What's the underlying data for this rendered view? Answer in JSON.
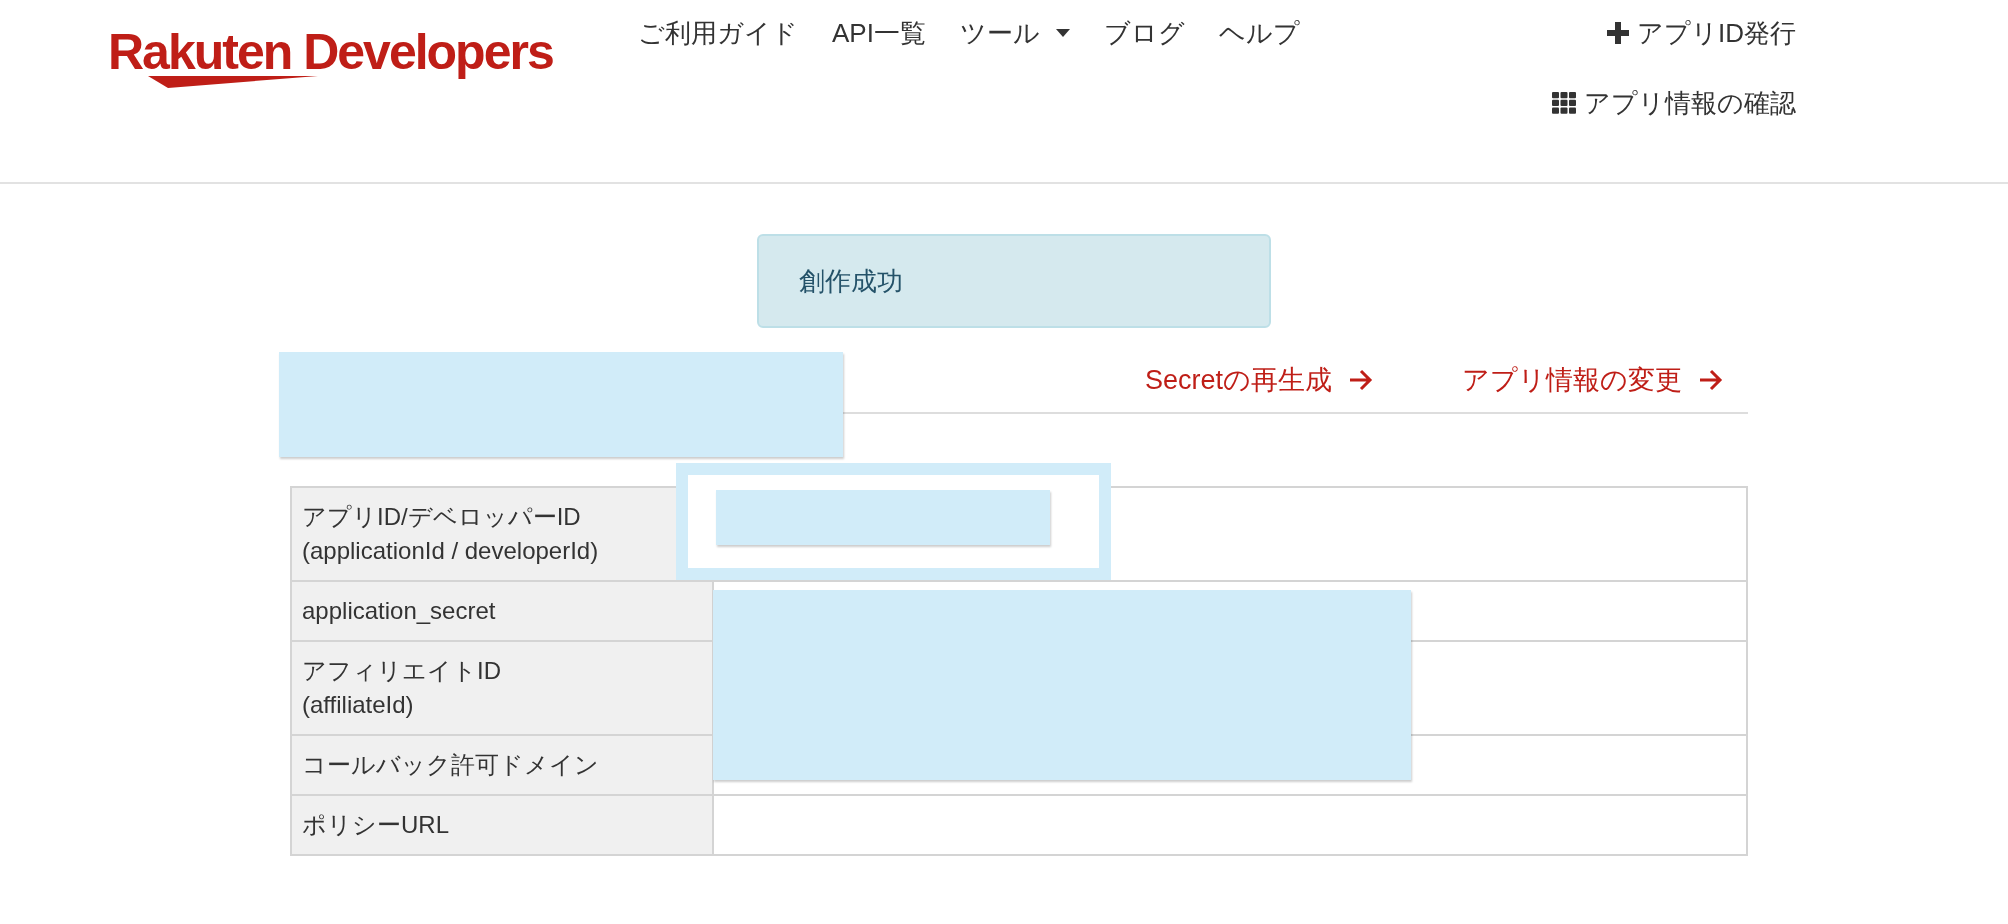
{
  "header": {
    "logo": "Rakuten Developers",
    "nav": [
      {
        "label": "ご利用ガイド",
        "dropdown": false
      },
      {
        "label": "API一覧",
        "dropdown": false
      },
      {
        "label": "ツール",
        "dropdown": true
      },
      {
        "label": "ブログ",
        "dropdown": false
      },
      {
        "label": "ヘルプ",
        "dropdown": false
      }
    ],
    "actions": [
      {
        "label": "アプリID発行",
        "kind": "plus"
      },
      {
        "label": "アプリ情報の確認",
        "kind": "grid"
      }
    ]
  },
  "alert": {
    "text": "創作成功"
  },
  "links": [
    {
      "label": "Secretの再生成"
    },
    {
      "label": "アプリ情報の変更"
    }
  ],
  "table": {
    "rows": [
      {
        "label": "アプリID/デベロッパーID",
        "sublabel": "(applicationId / developerId)"
      },
      {
        "label": "application_secret"
      },
      {
        "label": "アフィリエイトID",
        "sublabel": "(affiliateId)"
      },
      {
        "label": "コールバック許可ドメイン"
      },
      {
        "label": "ポリシーURL"
      }
    ]
  }
}
